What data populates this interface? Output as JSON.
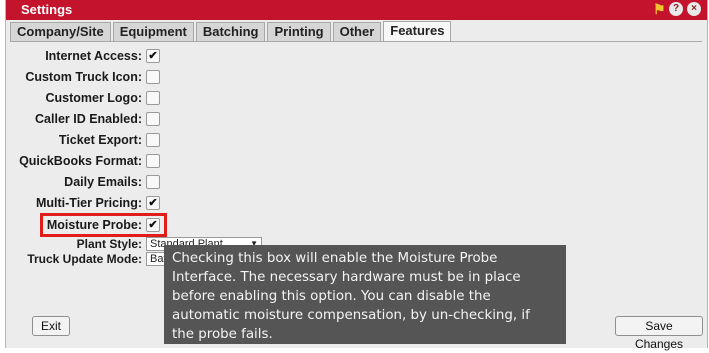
{
  "window": {
    "title": "Settings"
  },
  "tabs": [
    "Company/Site",
    "Equipment",
    "Batching",
    "Printing",
    "Other",
    "Features"
  ],
  "active_tab": "Features",
  "features": [
    {
      "label": "Internet Access:",
      "checked": true
    },
    {
      "label": "Custom Truck Icon:",
      "checked": false
    },
    {
      "label": "Customer Logo:",
      "checked": false
    },
    {
      "label": "Caller ID Enabled:",
      "checked": false
    },
    {
      "label": "Ticket Export:",
      "checked": false
    },
    {
      "label": "QuickBooks Format:",
      "checked": false
    },
    {
      "label": "Daily Emails:",
      "checked": false
    },
    {
      "label": "Multi-Tier Pricing:",
      "checked": true
    },
    {
      "label": "Moisture Probe:",
      "checked": true
    }
  ],
  "plant_style": {
    "label": "Plant Style:",
    "value": "Standard Plant"
  },
  "truck_update_mode": {
    "label": "Truck Update Mode:",
    "value": "Batc"
  },
  "tooltip": {
    "lines": [
      "Checking this box will enable the Moisture Probe",
      "Interface.  The necessary hardware must be in place",
      "before enabling this option.  You can disable the",
      "automatic moisture compensation, by un-checking, if",
      "the probe fails."
    ]
  },
  "buttons": {
    "exit": "Exit",
    "save": "Save Changes"
  },
  "colors": {
    "title_bar": "#c4132d",
    "highlight": "#e21b1b",
    "tooltip_bg": "#555555"
  },
  "icons": [
    "key-icon",
    "help-icon",
    "close-icon"
  ]
}
